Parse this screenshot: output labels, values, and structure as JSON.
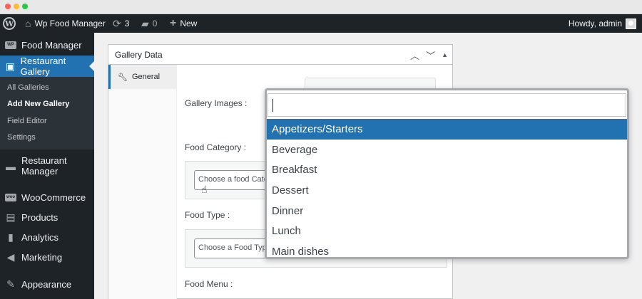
{
  "admin_bar": {
    "site_name": "Wp Food Manager",
    "updates_count": "3",
    "comments_count": "0",
    "new_label": "New",
    "howdy": "Howdy, admin"
  },
  "sidebar": {
    "items": [
      {
        "label": "Food Manager",
        "icon": "food-manager-icon"
      },
      {
        "label": "Restaurant Gallery",
        "icon": "gallery-icon"
      },
      {
        "label": "Restaurant Manager",
        "icon": "restaurant-icon"
      },
      {
        "label": "WooCommerce",
        "icon": "woocommerce-icon"
      },
      {
        "label": "Products",
        "icon": "products-icon"
      },
      {
        "label": "Analytics",
        "icon": "analytics-icon"
      },
      {
        "label": "Marketing",
        "icon": "megaphone-icon"
      },
      {
        "label": "Appearance",
        "icon": "brush-icon"
      }
    ],
    "submenu": [
      {
        "label": "All Galleries"
      },
      {
        "label": "Add New Gallery"
      },
      {
        "label": "Field Editor"
      },
      {
        "label": "Settings"
      }
    ]
  },
  "postbox": {
    "title": "Gallery Data",
    "tab_general": "General",
    "gallery_images_label": "Gallery Images :",
    "food_category_label": "Food Category :",
    "food_category_placeholder": "Choose a food Category",
    "food_type_label": "Food Type :",
    "food_type_placeholder": "Choose a Food Type",
    "food_menu_label": "Food Menu :"
  },
  "dropdown": {
    "search_value": "",
    "options": [
      {
        "label": "Appetizers/Starters",
        "highlighted": true
      },
      {
        "label": "Beverage",
        "highlighted": false
      },
      {
        "label": "Breakfast",
        "highlighted": false
      },
      {
        "label": "Dessert",
        "highlighted": false
      },
      {
        "label": "Dinner",
        "highlighted": false
      },
      {
        "label": "Lunch",
        "highlighted": false
      },
      {
        "label": "Main dishes",
        "highlighted": false
      }
    ]
  },
  "colors": {
    "admin_dark": "#1d2327",
    "accent_blue": "#2271b1",
    "page_bg": "#f0f0f1"
  }
}
